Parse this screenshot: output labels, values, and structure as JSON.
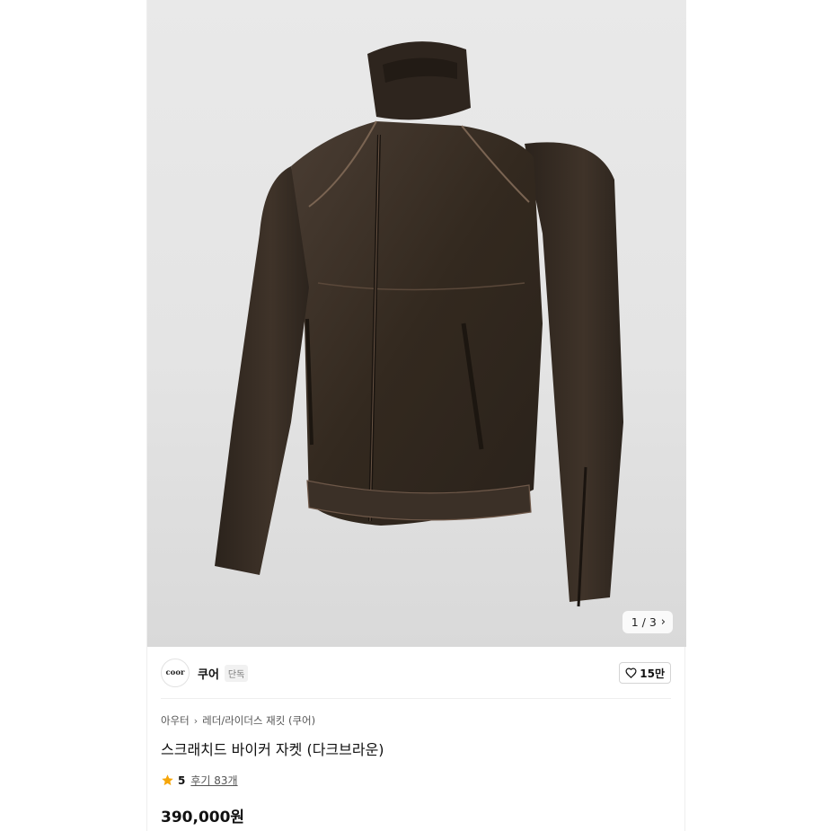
{
  "gallery": {
    "image_alt": "scratched biker jacket dark brown product photo",
    "current": "1",
    "total": "3",
    "counter": "1 / 3"
  },
  "brand": {
    "logo_text": "coor",
    "name": "쿠어",
    "badge": "단독"
  },
  "like": {
    "count": "15만"
  },
  "breadcrumb": {
    "category": "아우터",
    "subcategory": "레더/라이더스 재킷 (쿠어)"
  },
  "product": {
    "title": "스크래치드 바이커 자켓 (다크브라운)",
    "rating": "5",
    "reviews": "후기 83개",
    "price": "390,000원"
  },
  "colors": {
    "star": "#f6a609",
    "jacket": "#3a2f27"
  }
}
